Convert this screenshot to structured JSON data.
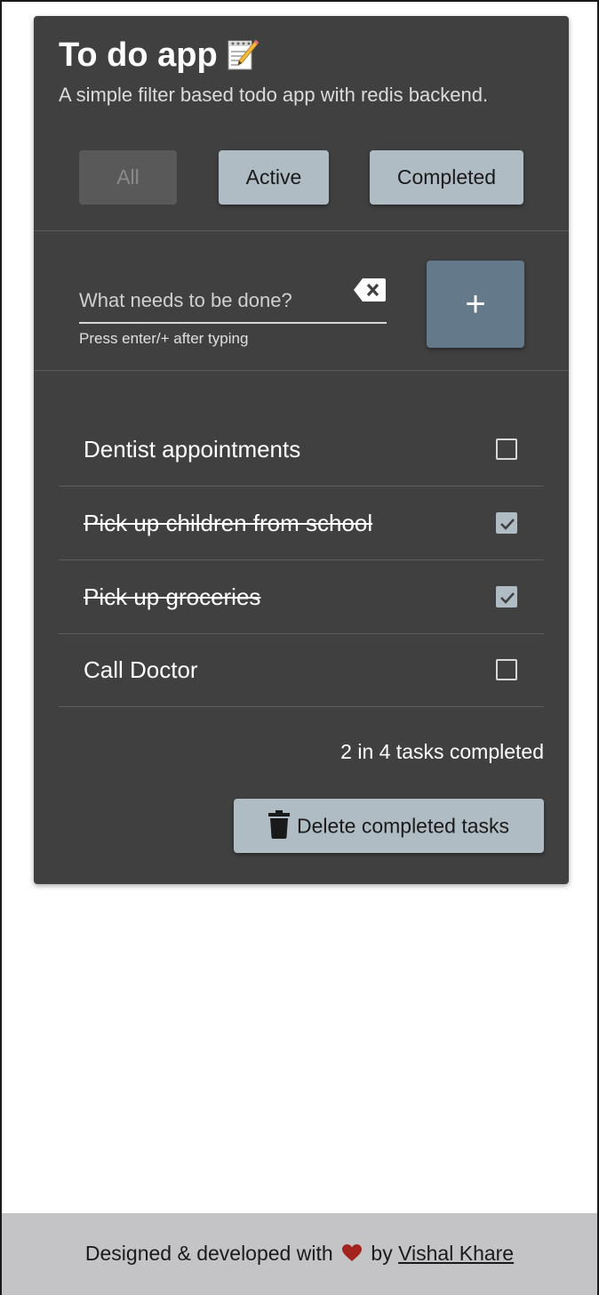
{
  "header": {
    "title": "To do app",
    "subtitle": "A simple filter based todo app with redis backend."
  },
  "filters": {
    "all": "All",
    "active": "Active",
    "completed": "Completed",
    "selected": "all"
  },
  "new_task": {
    "placeholder": "What needs to be done?",
    "value": "",
    "helper": "Press enter/+ after typing",
    "add_label": "+"
  },
  "tasks": [
    {
      "label": "Dentist appointments",
      "completed": false
    },
    {
      "label": "Pick up children from school",
      "completed": true
    },
    {
      "label": "Pick up groceries",
      "completed": true
    },
    {
      "label": "Call Doctor",
      "completed": false
    }
  ],
  "summary": "2 in 4 tasks completed",
  "delete_label": "Delete completed tasks",
  "footer": {
    "prefix": "Designed & developed with",
    "by": "by",
    "author": "Vishal Khare"
  },
  "colors": {
    "card": "#404040",
    "button": "#b0bcc4",
    "add_button": "#64798a",
    "heart": "#a3241f",
    "footer": "#c4c4c6"
  },
  "icons": {
    "title": "memo-icon",
    "clear": "backspace-icon",
    "checkbox": "check-icon",
    "delete": "trash-icon",
    "footer": "heart-icon"
  }
}
